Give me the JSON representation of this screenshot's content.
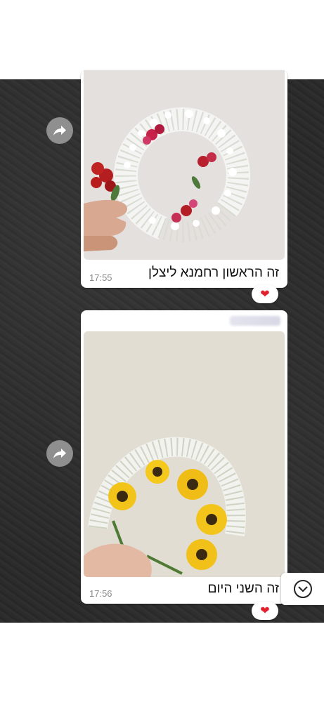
{
  "messages": [
    {
      "caption": "זה הראשון רחמנא ליצלן",
      "time": "17:55",
      "reaction": "❤"
    },
    {
      "caption": "זה השני היום",
      "time": "17:56",
      "reaction": "❤"
    }
  ],
  "icons": {
    "forward": "forward-icon",
    "scroll_down": "chevron-down-icon",
    "heart": "heart-icon"
  },
  "colors": {
    "chat_background": "#2b2b2b",
    "bubble": "#ffffff",
    "heart": "#e0222e"
  }
}
